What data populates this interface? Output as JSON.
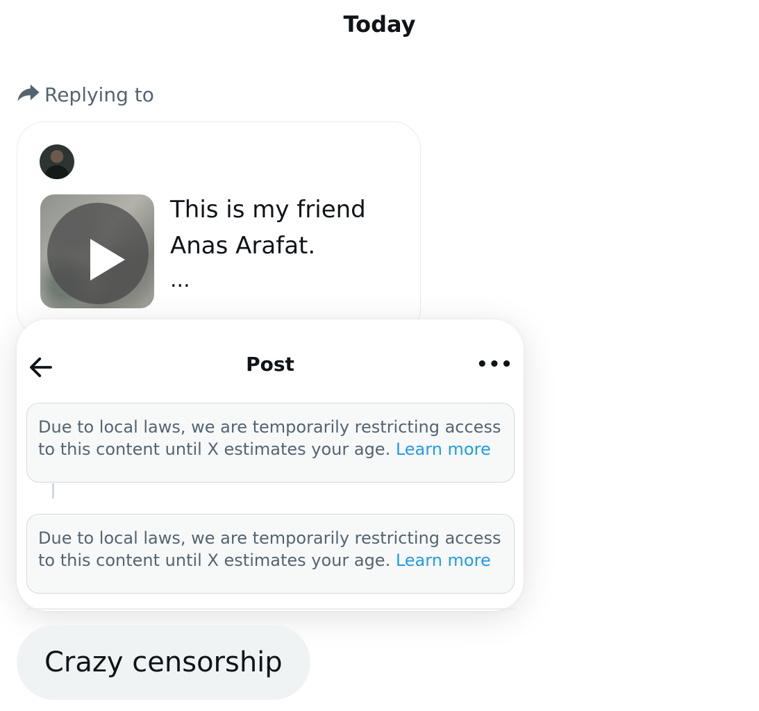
{
  "date_header": "Today",
  "reply_context": {
    "label": "Replying to",
    "icon": "reply-arrow-icon"
  },
  "quoted_post": {
    "avatar": "avatar",
    "media_type": "video",
    "text": "This is my friend Anas Arafat.",
    "truncation": "..."
  },
  "post_panel": {
    "title": "Post",
    "back_icon": "arrow-left-icon",
    "more_icon": "more-horizontal-icon",
    "more_glyph": "•••",
    "notices": [
      {
        "text": "Due to local laws, we are temporarily restricting access to this content until X estimates your age.",
        "link": "Learn more"
      },
      {
        "text": "Due to local laws, we are temporarily restricting access to this content until X estimates your age.",
        "link": "Learn more"
      }
    ]
  },
  "message": {
    "text": "Crazy censorship"
  },
  "colors": {
    "text_primary": "#0f1419",
    "text_secondary": "#536471",
    "link": "#1d9bf0",
    "bubble_bg": "#eff3f4",
    "notice_bg": "#f7f9f9"
  }
}
